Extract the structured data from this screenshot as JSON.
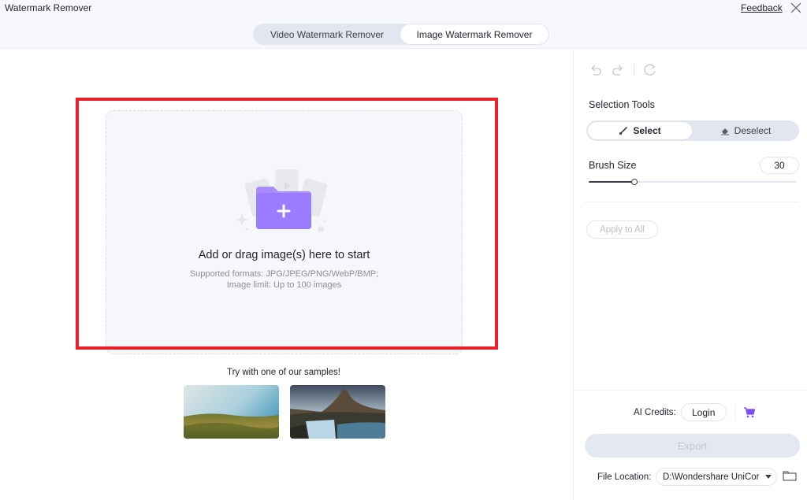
{
  "window": {
    "title": "Watermark Remover",
    "feedback_label": "Feedback",
    "close_icon": "close-icon"
  },
  "mode_tabs": [
    {
      "label": "Video Watermark Remover",
      "active": false
    },
    {
      "label": "Image Watermark Remover",
      "active": true
    }
  ],
  "dropzone": {
    "icon": "folder-add-icon",
    "title": "Add or drag image(s) here to start",
    "formats": "Supported formats: JPG/JPEG/PNG/WebP/BMP;",
    "limit": "Image limit: Up to 100 images"
  },
  "samples": {
    "label": "Try with one of our samples!",
    "items": [
      {
        "name": "grassland-sample"
      },
      {
        "name": "mountain-waterfall-sample"
      }
    ]
  },
  "panel": {
    "history_icons": [
      "undo-icon",
      "redo-icon",
      "reset-icon"
    ],
    "selection_tools_label": "Selection Tools",
    "select_label": "Select",
    "deselect_label": "Deselect",
    "active_tool": "Select",
    "brush_size_label": "Brush Size",
    "brush_size_value": "30",
    "brush_size_fraction": 0.22,
    "apply_all_label": "Apply to All",
    "ai_credits_label": "AI Credits:",
    "login_label": "Login",
    "export_label": "Export",
    "file_location_label": "File Location:",
    "file_location_value": "D:\\Wondershare UniCor"
  },
  "colors": {
    "accent_purple": "#9b7bff",
    "highlight_red": "#e8202a",
    "cart": "#7b4dff"
  }
}
